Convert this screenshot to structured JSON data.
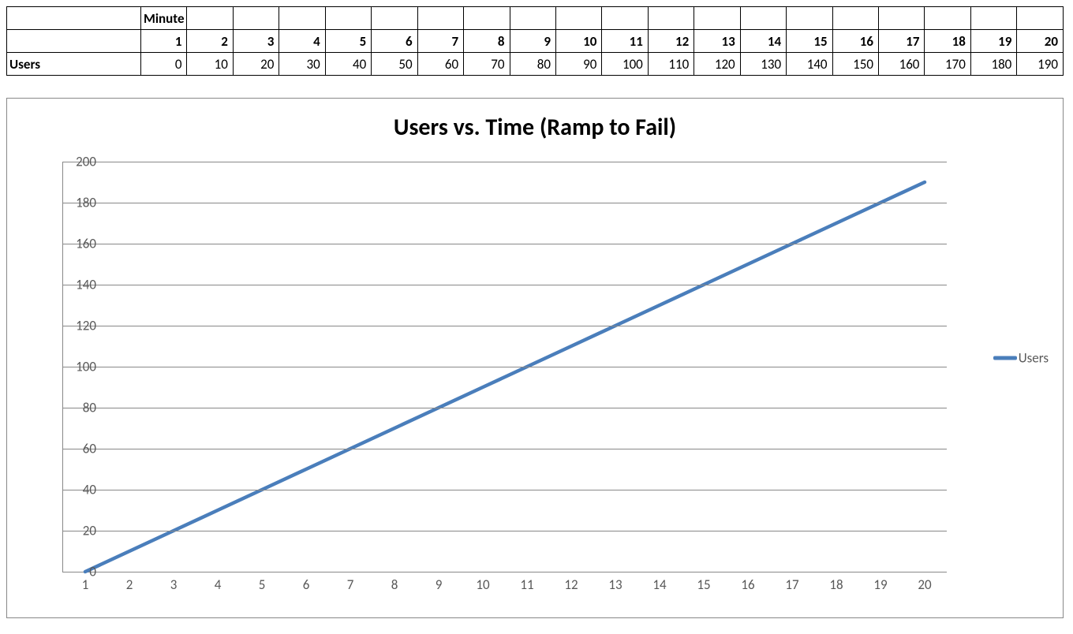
{
  "table": {
    "col_header_label": "Minute",
    "row_label": "Users",
    "minutes": [
      1,
      2,
      3,
      4,
      5,
      6,
      7,
      8,
      9,
      10,
      11,
      12,
      13,
      14,
      15,
      16,
      17,
      18,
      19,
      20
    ],
    "users": [
      0,
      10,
      20,
      30,
      40,
      50,
      60,
      70,
      80,
      90,
      100,
      110,
      120,
      130,
      140,
      150,
      160,
      170,
      180,
      190
    ]
  },
  "chart_data": {
    "type": "line",
    "title": "Users vs. Time (Ramp to Fail)",
    "xlabel": "",
    "ylabel": "",
    "categories": [
      1,
      2,
      3,
      4,
      5,
      6,
      7,
      8,
      9,
      10,
      11,
      12,
      13,
      14,
      15,
      16,
      17,
      18,
      19,
      20
    ],
    "series": [
      {
        "name": "Users",
        "values": [
          0,
          10,
          20,
          30,
          40,
          50,
          60,
          70,
          80,
          90,
          100,
          110,
          120,
          130,
          140,
          150,
          160,
          170,
          180,
          190
        ]
      }
    ],
    "ylim": [
      0,
      200
    ],
    "ytick_step": 20,
    "grid": true,
    "legend_position": "right",
    "line_color": "#4a7ebb"
  }
}
